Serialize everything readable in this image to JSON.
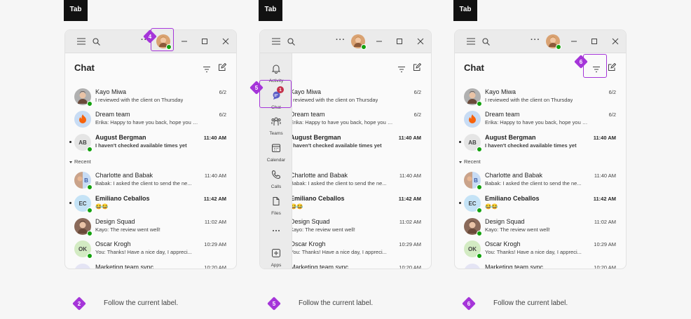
{
  "tab_key_label": "Tab",
  "chat": {
    "title": "Chat",
    "recent_label": "Recent",
    "pinned": [
      {
        "name": "Kayo Miwa",
        "message": "I reviewed with the client on Thursday",
        "time": "6/2",
        "bold": false,
        "unread": false,
        "avatar": "photo",
        "avatar_color": "#b0b0b0"
      },
      {
        "name": "Dream team",
        "message": "Erika: Happy to have you back, hope you had...",
        "time": "6/2",
        "bold": false,
        "unread": false,
        "avatar": "fire",
        "avatar_color": "#c8dcf4"
      },
      {
        "name": "August Bergman",
        "message": "I haven't checked available times yet",
        "time": "11:40 AM",
        "bold": true,
        "unread": true,
        "avatar": "AB",
        "avatar_color": "#e5e5e5"
      }
    ],
    "recent": [
      {
        "name": "Charlotte and Babak",
        "message": "Babak: I asked the client to send the ne...",
        "time": "11:40 AM",
        "bold": false,
        "unread": false,
        "avatar": "B",
        "avatar_color": "#c8dcf4"
      },
      {
        "name": "Emiliano Ceballos",
        "message": "😂😂",
        "time": "11:42 AM",
        "bold": true,
        "unread": true,
        "avatar": "EC",
        "avatar_color": "#c5e3f6"
      },
      {
        "name": "Design Squad",
        "message": "Kayo: The review went well!",
        "time": "11:02 AM",
        "bold": false,
        "unread": false,
        "avatar": "photo",
        "avatar_color": "#8a6a5a"
      },
      {
        "name": "Oscar Krogh",
        "message": "You: Thanks! Have a nice day, I appreci...",
        "time": "10:29 AM",
        "bold": false,
        "unread": false,
        "avatar": "OK",
        "avatar_color": "#d3ebc3"
      },
      {
        "name": "Marketing team sync",
        "message": "",
        "time": "10:20 AM",
        "bold": false,
        "unread": false,
        "avatar": "cal",
        "avatar_color": "#e4e4f4"
      }
    ]
  },
  "rail": {
    "items": [
      {
        "label": "Activity",
        "icon": "bell-icon"
      },
      {
        "label": "Chat",
        "icon": "chat-icon",
        "badge": "1"
      },
      {
        "label": "Teams",
        "icon": "teams-icon"
      },
      {
        "label": "Calendar",
        "icon": "calendar-icon"
      },
      {
        "label": "Calls",
        "icon": "phone-icon"
      },
      {
        "label": "Files",
        "icon": "file-icon"
      },
      {
        "label": "",
        "icon": "more-icon"
      },
      {
        "label": "Apps",
        "icon": "apps-icon"
      }
    ]
  },
  "steps": [
    {
      "marker": "4",
      "caption_marker": "2",
      "caption": "Follow the current label."
    },
    {
      "marker": "5",
      "caption_marker": "5",
      "caption": "Follow the current label."
    },
    {
      "marker": "6",
      "caption_marker": "6",
      "caption": "Follow the current label."
    }
  ],
  "colors": {
    "accent": "#a535d9",
    "presence": "#13a10e",
    "badge": "#c4314b"
  }
}
